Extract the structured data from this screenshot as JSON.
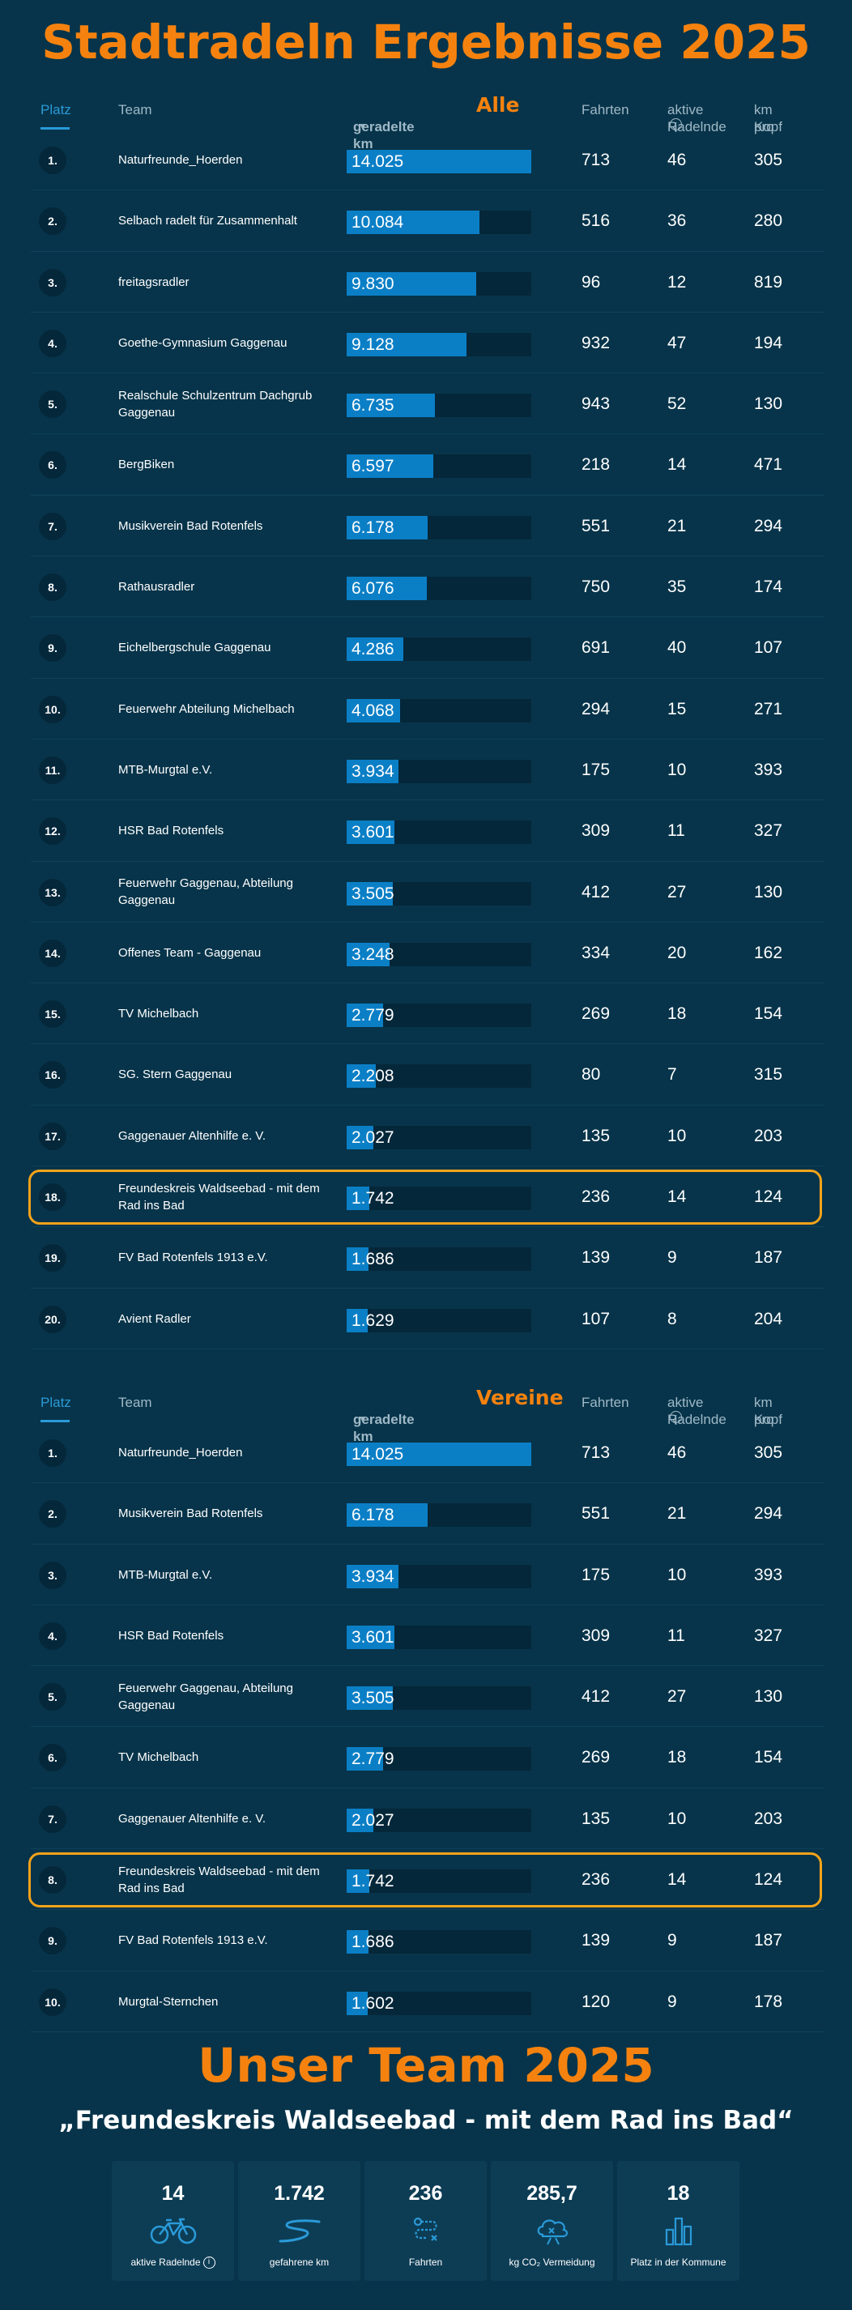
{
  "titles": {
    "main": "Stadtradeln Ergebnisse 2025",
    "team_section": "Unser Team 2025",
    "team_name": "„Freundeskreis Waldseebad - mit dem Rad ins Bad“"
  },
  "columns": {
    "platz": "Platz",
    "team": "Team",
    "km": "geradelte km",
    "fahrten": "Fahrten",
    "aktive_line1": "aktive",
    "aktive_line2": "Radelnde",
    "kopf_line1": "km pro",
    "kopf_line2": "Kopf"
  },
  "colors": {
    "background": "#07344a",
    "accent": "#f5820f",
    "bar": "#0b7fc6",
    "highlight_border": "#f5a31a"
  },
  "max_km": 14025,
  "sections": [
    {
      "label": "Alle",
      "highlight_rank": "18.",
      "rows": [
        {
          "rank": "1.",
          "team": "Naturfreunde_Hoerden",
          "km": "14.025",
          "km_value": 14025,
          "fahrten": "713",
          "aktive": "46",
          "kopf": "305"
        },
        {
          "rank": "2.",
          "team": "Selbach radelt für Zusammenhalt",
          "km": "10.084",
          "km_value": 10084,
          "fahrten": "516",
          "aktive": "36",
          "kopf": "280"
        },
        {
          "rank": "3.",
          "team": "freitagsradler",
          "km": "9.830",
          "km_value": 9830,
          "fahrten": "96",
          "aktive": "12",
          "kopf": "819"
        },
        {
          "rank": "4.",
          "team": "Goethe-Gymnasium Gaggenau",
          "km": "9.128",
          "km_value": 9128,
          "fahrten": "932",
          "aktive": "47",
          "kopf": "194"
        },
        {
          "rank": "5.",
          "team": "Realschule Schulzentrum Dachgrub Gaggenau",
          "km": "6.735",
          "km_value": 6735,
          "fahrten": "943",
          "aktive": "52",
          "kopf": "130"
        },
        {
          "rank": "6.",
          "team": "BergBiken",
          "km": "6.597",
          "km_value": 6597,
          "fahrten": "218",
          "aktive": "14",
          "kopf": "471"
        },
        {
          "rank": "7.",
          "team": "Musikverein Bad Rotenfels",
          "km": "6.178",
          "km_value": 6178,
          "fahrten": "551",
          "aktive": "21",
          "kopf": "294"
        },
        {
          "rank": "8.",
          "team": "Rathausradler",
          "km": "6.076",
          "km_value": 6076,
          "fahrten": "750",
          "aktive": "35",
          "kopf": "174"
        },
        {
          "rank": "9.",
          "team": "Eichelbergschule Gaggenau",
          "km": "4.286",
          "km_value": 4286,
          "fahrten": "691",
          "aktive": "40",
          "kopf": "107"
        },
        {
          "rank": "10.",
          "team": "Feuerwehr Abteilung Michelbach",
          "km": "4.068",
          "km_value": 4068,
          "fahrten": "294",
          "aktive": "15",
          "kopf": "271"
        },
        {
          "rank": "11.",
          "team": "MTB-Murgtal e.V.",
          "km": "3.934",
          "km_value": 3934,
          "fahrten": "175",
          "aktive": "10",
          "kopf": "393"
        },
        {
          "rank": "12.",
          "team": "HSR Bad Rotenfels",
          "km": "3.601",
          "km_value": 3601,
          "fahrten": "309",
          "aktive": "11",
          "kopf": "327"
        },
        {
          "rank": "13.",
          "team": "Feuerwehr Gaggenau, Abteilung Gaggenau",
          "km": "3.505",
          "km_value": 3505,
          "fahrten": "412",
          "aktive": "27",
          "kopf": "130"
        },
        {
          "rank": "14.",
          "team": "Offenes Team - Gaggenau",
          "km": "3.248",
          "km_value": 3248,
          "fahrten": "334",
          "aktive": "20",
          "kopf": "162"
        },
        {
          "rank": "15.",
          "team": "TV Michelbach",
          "km": "2.779",
          "km_value": 2779,
          "fahrten": "269",
          "aktive": "18",
          "kopf": "154"
        },
        {
          "rank": "16.",
          "team": "SG. Stern Gaggenau",
          "km": "2.208",
          "km_value": 2208,
          "fahrten": "80",
          "aktive": "7",
          "kopf": "315"
        },
        {
          "rank": "17.",
          "team": "Gaggenauer Altenhilfe e. V.",
          "km": "2.027",
          "km_value": 2027,
          "fahrten": "135",
          "aktive": "10",
          "kopf": "203"
        },
        {
          "rank": "18.",
          "team": "Freundeskreis Waldseebad - mit dem Rad ins Bad",
          "km": "1.742",
          "km_value": 1742,
          "fahrten": "236",
          "aktive": "14",
          "kopf": "124"
        },
        {
          "rank": "19.",
          "team": "FV Bad Rotenfels 1913 e.V.",
          "km": "1.686",
          "km_value": 1686,
          "fahrten": "139",
          "aktive": "9",
          "kopf": "187"
        },
        {
          "rank": "20.",
          "team": "Avient Radler",
          "km": "1.629",
          "km_value": 1629,
          "fahrten": "107",
          "aktive": "8",
          "kopf": "204"
        }
      ]
    },
    {
      "label": "Vereine",
      "highlight_rank": "8.",
      "rows": [
        {
          "rank": "1.",
          "team": "Naturfreunde_Hoerden",
          "km": "14.025",
          "km_value": 14025,
          "fahrten": "713",
          "aktive": "46",
          "kopf": "305"
        },
        {
          "rank": "2.",
          "team": "Musikverein Bad Rotenfels",
          "km": "6.178",
          "km_value": 6178,
          "fahrten": "551",
          "aktive": "21",
          "kopf": "294"
        },
        {
          "rank": "3.",
          "team": "MTB-Murgtal e.V.",
          "km": "3.934",
          "km_value": 3934,
          "fahrten": "175",
          "aktive": "10",
          "kopf": "393"
        },
        {
          "rank": "4.",
          "team": "HSR Bad Rotenfels",
          "km": "3.601",
          "km_value": 3601,
          "fahrten": "309",
          "aktive": "11",
          "kopf": "327"
        },
        {
          "rank": "5.",
          "team": "Feuerwehr Gaggenau, Abteilung Gaggenau",
          "km": "3.505",
          "km_value": 3505,
          "fahrten": "412",
          "aktive": "27",
          "kopf": "130"
        },
        {
          "rank": "6.",
          "team": "TV Michelbach",
          "km": "2.779",
          "km_value": 2779,
          "fahrten": "269",
          "aktive": "18",
          "kopf": "154"
        },
        {
          "rank": "7.",
          "team": "Gaggenauer Altenhilfe e. V.",
          "km": "2.027",
          "km_value": 2027,
          "fahrten": "135",
          "aktive": "10",
          "kopf": "203"
        },
        {
          "rank": "8.",
          "team": "Freundeskreis Waldseebad - mit dem Rad ins Bad",
          "km": "1.742",
          "km_value": 1742,
          "fahrten": "236",
          "aktive": "14",
          "kopf": "124"
        },
        {
          "rank": "9.",
          "team": "FV Bad Rotenfels 1913 e.V.",
          "km": "1.686",
          "km_value": 1686,
          "fahrten": "139",
          "aktive": "9",
          "kopf": "187"
        },
        {
          "rank": "10.",
          "team": "Murgtal-Sternchen",
          "km": "1.602",
          "km_value": 1602,
          "fahrten": "120",
          "aktive": "9",
          "kopf": "178"
        }
      ]
    }
  ],
  "stats": [
    {
      "value": "14",
      "label": "aktive Radelnde",
      "icon": "bicycle-icon",
      "info": true
    },
    {
      "value": "1.742",
      "label": "gefahrene km",
      "icon": "route-icon",
      "info": false
    },
    {
      "value": "236",
      "label": "Fahrten",
      "icon": "trips-icon",
      "info": false
    },
    {
      "value": "285,7",
      "label": "kg CO₂ Vermeidung",
      "icon": "co2-cloud-icon",
      "info": false
    },
    {
      "value": "18",
      "label": "Platz in der Kommune",
      "icon": "bar-chart-icon",
      "info": false
    }
  ]
}
